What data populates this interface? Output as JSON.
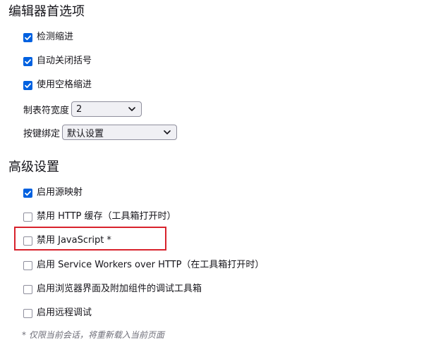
{
  "editor_prefs": {
    "title": "编辑器首选项",
    "checkboxes": [
      {
        "label": "检测缩进",
        "checked": true
      },
      {
        "label": "自动关闭括号",
        "checked": true
      },
      {
        "label": "使用空格缩进",
        "checked": true
      }
    ],
    "tab_size": {
      "label": "制表符宽度",
      "value": "2"
    },
    "keybinding": {
      "label": "按键绑定",
      "value": "默认设置"
    }
  },
  "advanced": {
    "title": "高级设置",
    "checkboxes": [
      {
        "label": "启用源映射",
        "checked": true
      },
      {
        "label": "禁用 HTTP 缓存（工具箱打开时）",
        "checked": false
      },
      {
        "label": "禁用 JavaScript *",
        "checked": false
      },
      {
        "label": "启用 Service Workers over HTTP（在工具箱打开时）",
        "checked": false
      },
      {
        "label": "启用浏览器界面及附加组件的调试工具箱",
        "checked": false
      },
      {
        "label": "启用远程调试",
        "checked": false
      }
    ],
    "footnote": "* 仅限当前会话，将重新载入当前页面"
  },
  "colors": {
    "accent": "#0061e0",
    "highlight": "#d8222c"
  },
  "icons": {
    "checkbox_mark": "checkmark-icon",
    "select_arrow": "chevron-down-icon"
  }
}
